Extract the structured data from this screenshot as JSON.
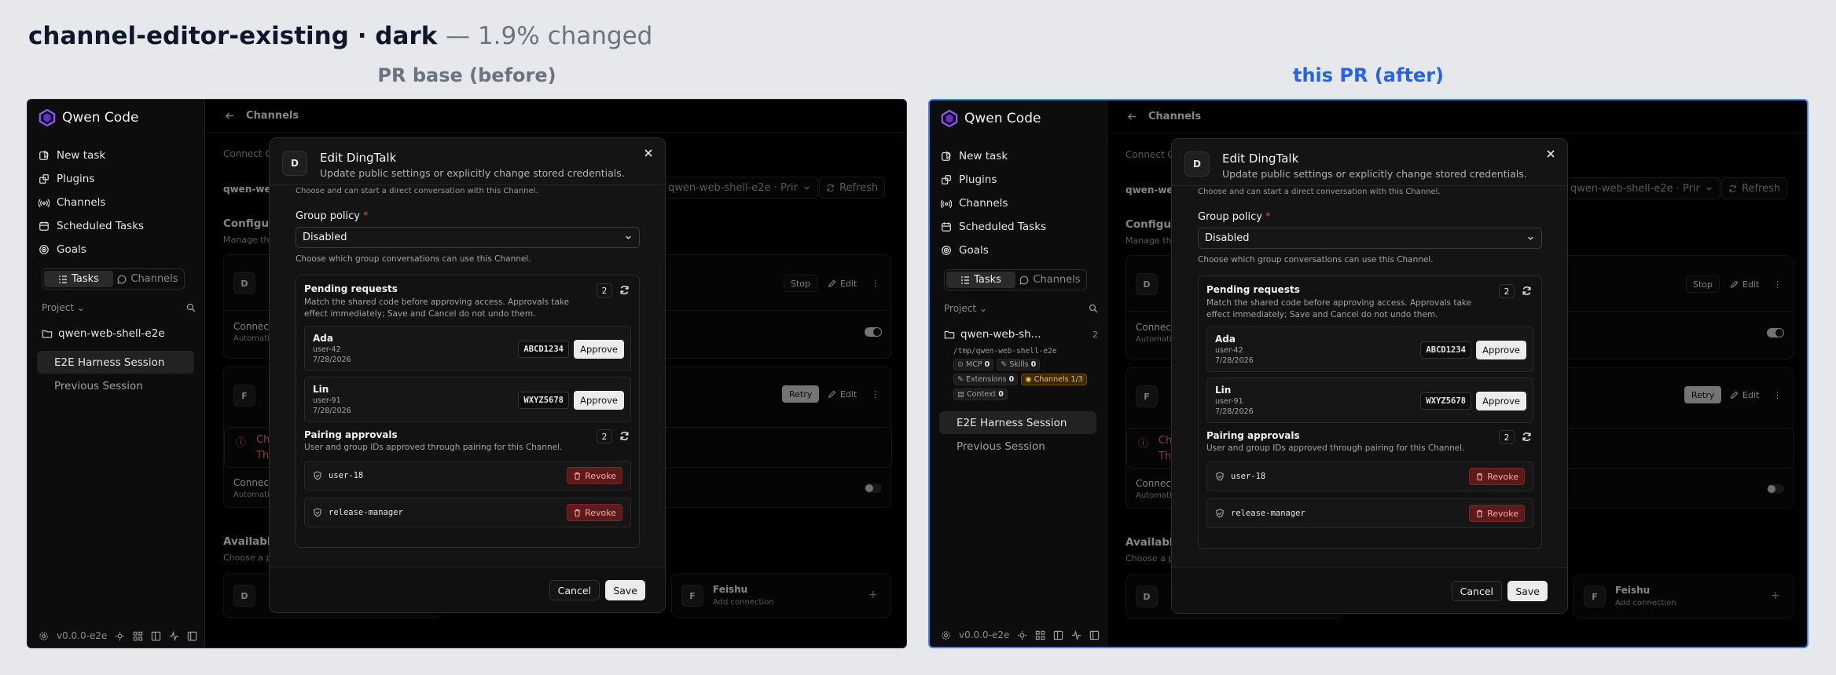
{
  "header": {
    "title": "channel-editor-existing · dark",
    "subtitle": "— 1.9% changed"
  },
  "captions": {
    "before": "PR base (before)",
    "after": "this PR (after)"
  },
  "colors": {
    "before_caption": "#6b7280",
    "after_caption": "#2563eb",
    "accent_border": "#3b82f6"
  },
  "app": {
    "brand": "Qwen Code",
    "nav": [
      "New task",
      "Plugins",
      "Channels",
      "Scheduled Tasks",
      "Goals"
    ],
    "nav_icons": [
      "new-task-icon",
      "plugins-icon",
      "channels-icon",
      "scheduled-tasks-icon",
      "goals-icon"
    ],
    "seg_tasks": "Tasks",
    "seg_channels": "Channels",
    "project_label": "Project",
    "workspace_before": "qwen-web-shell-e2e",
    "workspace_after": "qwen-web-sh...",
    "workspace_count": "2",
    "workspace_path": "/tmp/qwen-web-shell-e2e",
    "chips": [
      {
        "label": "MCP",
        "value": "0"
      },
      {
        "label": "Skills",
        "value": "0"
      },
      {
        "label": "Extensions",
        "value": "0"
      },
      {
        "label": "Channels 1/3",
        "value": ""
      },
      {
        "label": "Context",
        "value": "0"
      }
    ],
    "session_active": "E2E Harness Session",
    "session_prev": "Previous Session",
    "version": "v0.0.0-e2e",
    "topbar_title": "Channels",
    "bg": {
      "connect": "Connect Q",
      "ws_label": "qwen-web",
      "select": "qwen-web-shell-e2e · Prir",
      "refresh": "Refresh",
      "configure": "Configur",
      "manage": "Manage the",
      "stop": "Stop",
      "edit": "Edit",
      "retry": "Retry",
      "connect2": "Connect",
      "automation": "Automatio",
      "err1": "Ch",
      "err2": "The",
      "available": "Availabl",
      "choose": "Choose a p",
      "feishu": "Feishu",
      "add_connection": "Add connection",
      "card_d": "D",
      "card_f": "F"
    }
  },
  "modal": {
    "avatar": "D",
    "title": "Edit DingTalk",
    "subtitle": "Update public settings or explicitly change stored credentials.",
    "cut_text": "Choose and can start a direct conversation with this Channel.",
    "group_policy_label": "Group policy",
    "required_mark": "*",
    "group_policy_value": "Disabled",
    "group_policy_help": "Choose which group conversations can use this Channel.",
    "pending": {
      "title": "Pending requests",
      "desc": "Match the shared code before approving access. Approvals take effect immediately; Save and Cancel do not undo them.",
      "count": "2",
      "items": [
        {
          "name": "Ada",
          "id": "user-42",
          "date": "7/28/2026",
          "code": "ABCD1234",
          "action": "Approve"
        },
        {
          "name": "Lin",
          "id": "user-91",
          "date": "7/28/2026",
          "code": "WXYZ5678",
          "action": "Approve"
        }
      ]
    },
    "pairing": {
      "title": "Pairing approvals",
      "desc": "User and group IDs approved through pairing for this Channel.",
      "count": "2",
      "items": [
        {
          "id": "user-18",
          "action": "Revoke"
        },
        {
          "id": "release-manager",
          "action": "Revoke"
        }
      ]
    },
    "cancel": "Cancel",
    "save": "Save"
  }
}
